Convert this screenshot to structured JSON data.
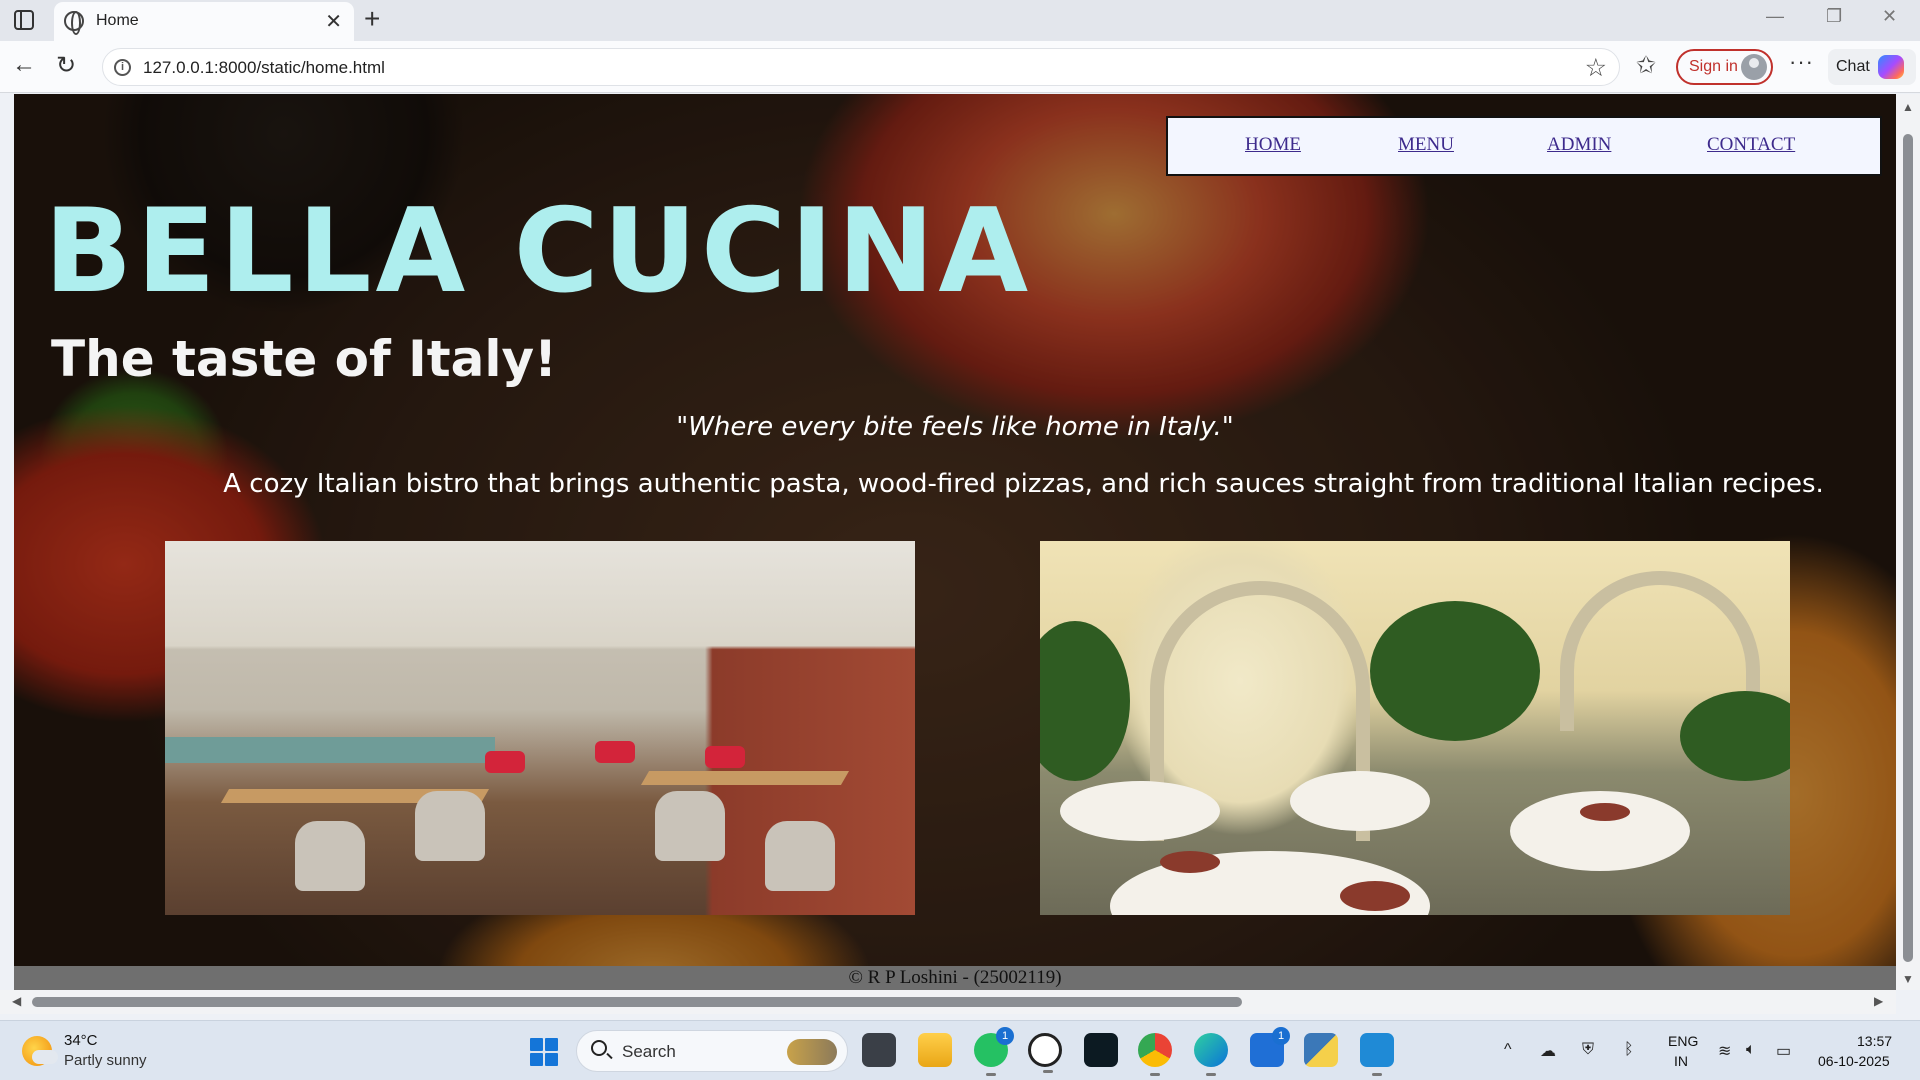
{
  "browser": {
    "tab_title": "Home",
    "close_glyph": "✕",
    "new_tab_glyph": "+",
    "url": "127.0.0.1:8000/static/home.html",
    "sign_in": "Sign in",
    "chat": "Chat",
    "window_controls": {
      "minimize": "—",
      "restore": "❐",
      "close": "✕"
    }
  },
  "site": {
    "nav": [
      {
        "label": "HOME"
      },
      {
        "label": "MENU"
      },
      {
        "label": "ADMIN"
      },
      {
        "label": "CONTACT"
      }
    ],
    "brand": "BELLA CUCINA",
    "tagline": "The taste of Italy!",
    "quote": "\"Where every bite feels like home in Italy.\"",
    "description": "A cozy Italian bistro that brings authentic pasta, wood-fired pizzas, and rich sauces straight from traditional Italian recipes.",
    "footer": "© R P Loshini - (25002119)",
    "colors": {
      "brand": "#aeeeee",
      "nav_bg": "#f3f6ff",
      "nav_link": "#3d2a8c",
      "footer_bg": "#6f6f6f"
    }
  },
  "taskbar": {
    "weather_temp": "34°C",
    "weather_condition": "Partly sunny",
    "search_label": "Search",
    "apps": [
      {
        "icon": "file-explorer-icon"
      },
      {
        "icon": "folder-icon"
      },
      {
        "icon": "whatsapp-icon",
        "badge": "1"
      },
      {
        "icon": "chatgpt-icon"
      },
      {
        "icon": "ai-app-icon"
      },
      {
        "icon": "chrome-icon"
      },
      {
        "icon": "edge-icon"
      },
      {
        "icon": "store-icon",
        "badge": "1"
      },
      {
        "icon": "python-icon"
      },
      {
        "icon": "vscode-icon"
      }
    ],
    "lang_top": "ENG",
    "lang_bottom": "IN",
    "time": "13:57",
    "date": "06-10-2025"
  }
}
